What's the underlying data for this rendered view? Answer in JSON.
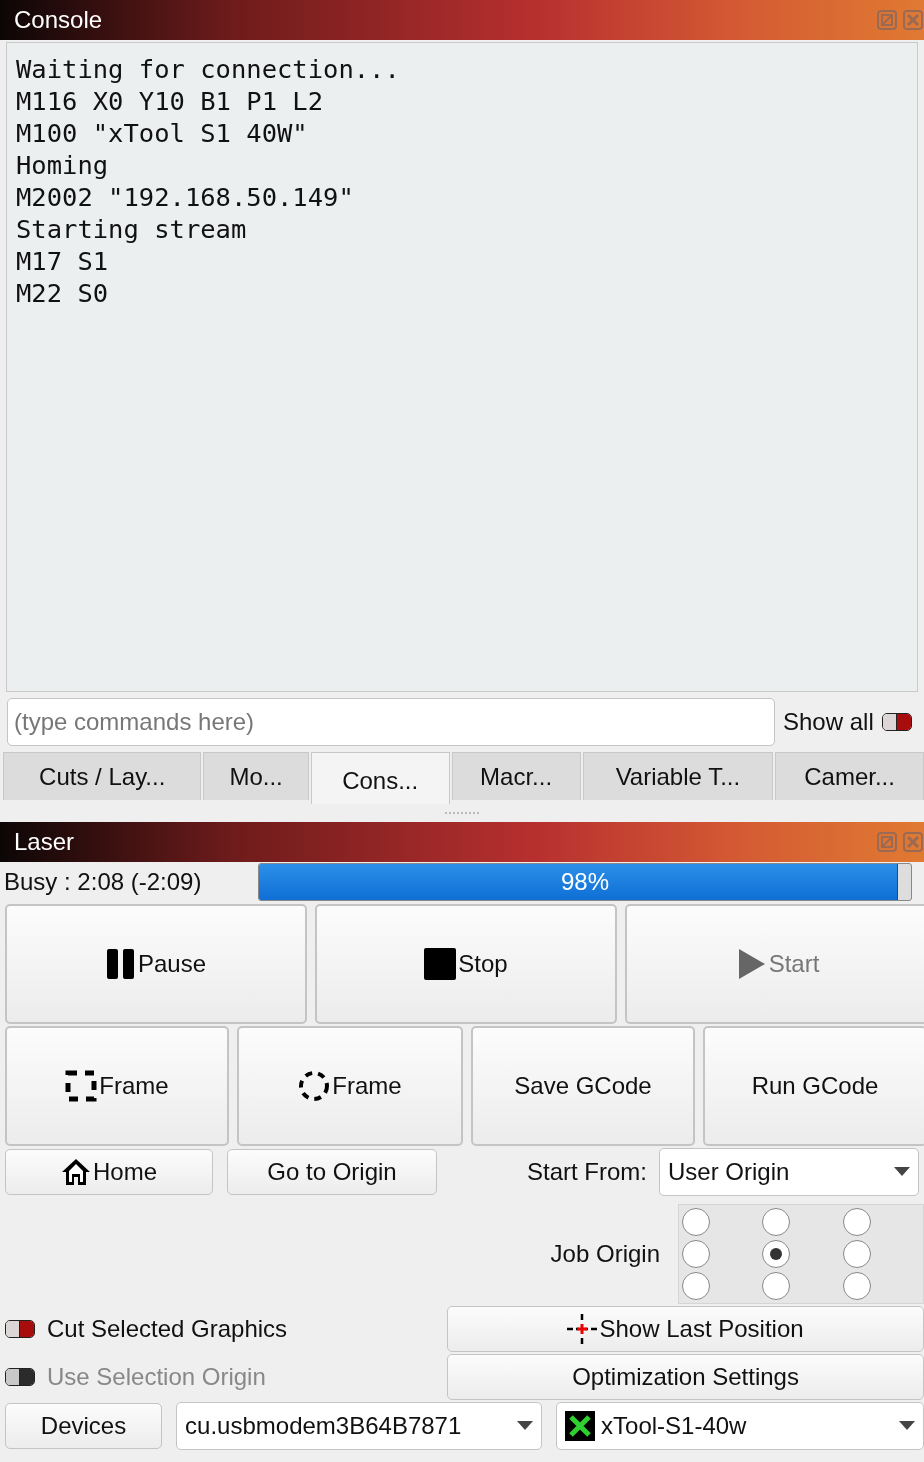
{
  "console": {
    "title": "Console",
    "lines": [
      "Waiting for connection...",
      "M116 X0 Y10 B1 P1 L2",
      "M100 \"xTool S1 40W\"",
      "Homing",
      "M2002 \"192.168.50.149\"",
      "Starting stream",
      "M17 S1",
      "M22 S0"
    ],
    "command": {
      "placeholder": "(type commands here)"
    },
    "show_all": {
      "label": "Show all",
      "on": true
    }
  },
  "tabs": [
    {
      "label": "Cuts / Lay...",
      "selected": false
    },
    {
      "label": "Mo...",
      "selected": false
    },
    {
      "label": "Cons...",
      "selected": true
    },
    {
      "label": "Macr...",
      "selected": false
    },
    {
      "label": "Variable T...",
      "selected": false
    },
    {
      "label": "Camer...",
      "selected": false
    }
  ],
  "laser": {
    "title": "Laser",
    "status": "Busy : 2:08 (-2:09)",
    "progress": {
      "level": 0.98,
      "label": "98%"
    },
    "primary_buttons": [
      {
        "label": "Pause",
        "kind": "pause",
        "disabled": false
      },
      {
        "label": "Stop",
        "kind": "stop",
        "disabled": false
      },
      {
        "label": "Start",
        "kind": "play",
        "disabled": true
      }
    ],
    "frame_buttons": [
      {
        "label": "Frame",
        "kind": "rect"
      },
      {
        "label": "Frame",
        "kind": "circle"
      },
      {
        "label": "Save GCode",
        "kind": "text"
      },
      {
        "label": "Run GCode",
        "kind": "text"
      }
    ],
    "home_button": "Home",
    "origin_button": "Go to Origin",
    "start_from": {
      "label": "Start From:",
      "value": "User Origin"
    },
    "job_origin": {
      "label": "Job Origin",
      "options": [
        {
          "selected": false
        },
        {
          "selected": false
        },
        {
          "selected": false
        },
        {
          "selected": false
        },
        {
          "selected": true
        },
        {
          "selected": false
        },
        {
          "selected": false
        },
        {
          "selected": false
        },
        {
          "selected": false
        }
      ]
    },
    "toggles": [
      {
        "label": "Cut Selected Graphics",
        "on": true,
        "disabled": false
      },
      {
        "label": "Use Selection Origin",
        "on": false,
        "disabled": true
      }
    ],
    "show_last_position": "Show Last Position",
    "optimization": "Optimization Settings",
    "devices_button": "Devices",
    "port": "cu.usbmodem3B64B7871",
    "device": "xTool-S1-40w"
  }
}
